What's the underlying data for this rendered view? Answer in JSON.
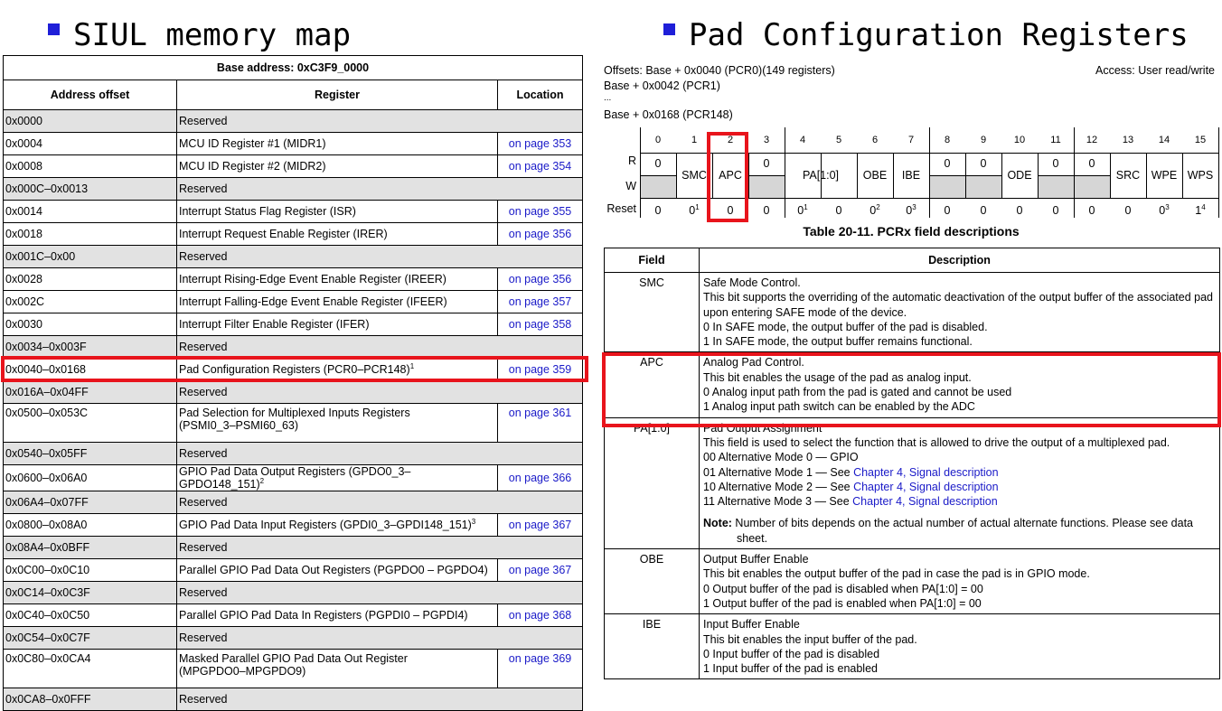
{
  "left_heading": "SIUL memory map",
  "right_heading": "Pad Configuration Registers",
  "memory_map": {
    "base_address": "Base address: 0xC3F9_0000",
    "columns": [
      "Address offset",
      "Register",
      "Location"
    ],
    "rows": [
      {
        "offset": "0x0000",
        "register": "Reserved",
        "location": "",
        "reserved": true
      },
      {
        "offset": "0x0004",
        "register": "MCU ID Register #1 (MIDR1)",
        "location": "on page 353",
        "reserved": false
      },
      {
        "offset": "0x0008",
        "register": "MCU ID Register #2 (MIDR2)",
        "location": "on page 354",
        "reserved": false
      },
      {
        "offset": "0x000C–0x0013",
        "register": "Reserved",
        "location": "",
        "reserved": true
      },
      {
        "offset": "0x0014",
        "register": "Interrupt Status Flag Register (ISR)",
        "location": "on page 355",
        "reserved": false
      },
      {
        "offset": "0x0018",
        "register": "Interrupt Request Enable Register (IRER)",
        "location": "on page 356",
        "reserved": false
      },
      {
        "offset": "0x001C–0x00",
        "register": "Reserved",
        "location": "",
        "reserved": true
      },
      {
        "offset": "0x0028",
        "register": "Interrupt Rising-Edge Event Enable Register (IREER)",
        "location": "on page 356",
        "reserved": false
      },
      {
        "offset": "0x002C",
        "register": "Interrupt Falling-Edge Event Enable Register (IFEER)",
        "location": "on page 357",
        "reserved": false
      },
      {
        "offset": "0x0030",
        "register": "Interrupt Filter Enable Register (IFER)",
        "location": "on page 358",
        "reserved": false
      },
      {
        "offset": "0x0034–0x003F",
        "register": "Reserved",
        "location": "",
        "reserved": true
      },
      {
        "offset": "0x0040–0x0168",
        "register": "Pad Configuration Registers (PCR0–PCR148)",
        "sup": "1",
        "location": "on page 359",
        "reserved": false
      },
      {
        "offset": "0x016A–0x04FF",
        "register": "Reserved",
        "location": "",
        "reserved": true
      },
      {
        "offset": "0x0500–0x053C",
        "register": "Pad Selection for Multiplexed Inputs Registers",
        "register2": "(PSMI0_3–PSMI60_63)",
        "location": "on page 361",
        "reserved": false
      },
      {
        "offset": "0x0540–0x05FF",
        "register": "Reserved",
        "location": "",
        "reserved": true
      },
      {
        "offset": "0x0600–0x06A0",
        "register": "GPIO Pad Data Output Registers (GPDO0_3–GPDO148_151)",
        "sup": "2",
        "location": "on page 366",
        "reserved": false
      },
      {
        "offset": "0x06A4–0x07FF",
        "register": "Reserved",
        "location": "",
        "reserved": true
      },
      {
        "offset": "0x0800–0x08A0",
        "register": "GPIO Pad Data Input Registers (GPDI0_3–GPDI148_151)",
        "sup": "3",
        "location": "on page 367",
        "reserved": false
      },
      {
        "offset": "0x08A4–0x0BFF",
        "register": "Reserved",
        "location": "",
        "reserved": true
      },
      {
        "offset": "0x0C00–0x0C10",
        "register": "Parallel GPIO Pad Data Out Registers (PGPDO0 – PGPDO4)",
        "location": "on page 367",
        "reserved": false
      },
      {
        "offset": "0x0C14–0x0C3F",
        "register": "Reserved",
        "location": "",
        "reserved": true
      },
      {
        "offset": "0x0C40–0x0C50",
        "register": "Parallel GPIO Pad Data In Registers (PGPDI0 – PGPDI4)",
        "location": "on page 368",
        "reserved": false
      },
      {
        "offset": "0x0C54–0x0C7F",
        "register": "Reserved",
        "location": "",
        "reserved": true
      },
      {
        "offset": "0x0C80–0x0CA4",
        "register": "Masked Parallel GPIO Pad Data Out Register",
        "register2": "(MPGPDO0–MPGPDO9)",
        "location": "on page 369",
        "reserved": false
      },
      {
        "offset": "0x0CA8–0x0FFF",
        "register": "Reserved",
        "location": "",
        "reserved": true
      }
    ]
  },
  "pcr": {
    "offsets_line1": "Offsets: Base + 0x0040 (PCR0)(149 registers)",
    "access": "Access: User read/write",
    "offsets_line2": "Base + 0x0042 (PCR1)",
    "ellipsis": "...",
    "offsets_line3": "Base + 0x0168 (PCR148)",
    "bit_numbers": [
      "0",
      "1",
      "2",
      "3",
      "4",
      "5",
      "6",
      "7",
      "8",
      "9",
      "10",
      "11",
      "12",
      "13",
      "14",
      "15"
    ],
    "row_labels": {
      "r": "R",
      "w": "W",
      "reset": "Reset"
    },
    "r_zeros": [
      "0",
      "0",
      "0",
      "0",
      "0"
    ],
    "fields": [
      "SMC",
      "APC",
      "PA[1:0]",
      "OBE",
      "IBE",
      "ODE",
      "SRC",
      "WPE",
      "WPS"
    ],
    "reset_values": [
      {
        "v": "0"
      },
      {
        "v": "0",
        "sup": "1"
      },
      {
        "v": "0"
      },
      {
        "v": "0"
      },
      {
        "v": "0",
        "sup": "1"
      },
      {
        "v": "0"
      },
      {
        "v": "0",
        "sup": "2"
      },
      {
        "v": "0",
        "sup": "3"
      },
      {
        "v": "0"
      },
      {
        "v": "0"
      },
      {
        "v": "0"
      },
      {
        "v": "0"
      },
      {
        "v": "0"
      },
      {
        "v": "0"
      },
      {
        "v": "0",
        "sup": "3"
      },
      {
        "v": "1",
        "sup": "4"
      }
    ],
    "caption": "Table 20-11. PCRx field descriptions"
  },
  "field_table": {
    "columns": [
      "Field",
      "Description"
    ],
    "rows": [
      {
        "field": "SMC",
        "lines": [
          "Safe Mode Control.",
          "This bit supports the overriding of the automatic deactivation of the output buffer of the associated pad upon entering SAFE mode of the device.",
          "0  In SAFE mode, the output buffer of the pad is disabled.",
          "1  In SAFE mode, the output buffer remains functional."
        ]
      },
      {
        "field": "APC",
        "lines": [
          "Analog Pad Control.",
          "This bit enables the usage of the pad as analog input.",
          "0   Analog input path from the pad is gated and cannot be used",
          "1   Analog input path switch can be enabled by the ADC"
        ]
      },
      {
        "field": "PA[1:0]",
        "lines": [
          "Pad Output Assignment",
          "This field is used to select the function that is allowed to drive the output of a multiplexed pad.",
          "00  Alternative Mode 0 — GPIO"
        ],
        "mode_lines": [
          {
            "prefix": "01  Alternative Mode 1 — See ",
            "link": "Chapter 4, Signal description"
          },
          {
            "prefix": "10  Alternative Mode 2 — See ",
            "link": "Chapter 4, Signal description"
          },
          {
            "prefix": "11  Alternative Mode 3 — See ",
            "link": "Chapter 4, Signal description"
          }
        ],
        "note_label": "Note:",
        "note_text": " Number of bits depends on the actual number of actual alternate functions. Please see data sheet."
      },
      {
        "field": "OBE",
        "lines": [
          "Output Buffer Enable",
          "This bit enables the output buffer of the pad in case the pad is in GPIO mode.",
          "0  Output buffer of the pad is disabled when PA[1:0] = 00",
          "1  Output buffer of the pad is enabled when PA[1:0] = 00"
        ]
      },
      {
        "field": "IBE",
        "lines": [
          "Input Buffer Enable",
          "This bit enables the input buffer of the pad.",
          "0  Input buffer of the pad is disabled",
          "1  Input buffer of the pad is enabled"
        ]
      }
    ]
  },
  "colors": {
    "highlight": "#e8141c",
    "bullet": "#1f1fd8",
    "link": "#1a1ac8",
    "reserved_fill": "#e2e2e2"
  }
}
